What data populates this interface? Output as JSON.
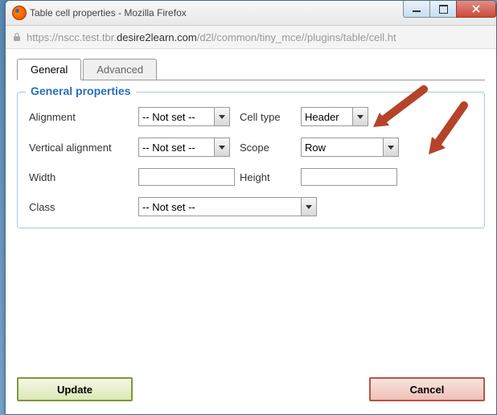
{
  "window": {
    "title": "Table cell properties - Mozilla Firefox",
    "url_pre": "https://nscc.test.tbr.",
    "url_domain": "desire2learn.com",
    "url_post": "/d2l/common/tiny_mce//plugins/table/cell.ht"
  },
  "tabs": {
    "general": "General",
    "advanced": "Advanced"
  },
  "fieldset": {
    "legend": "General properties"
  },
  "labels": {
    "alignment": "Alignment",
    "valign": "Vertical alignment",
    "width": "Width",
    "class": "Class",
    "celltype": "Cell type",
    "scope": "Scope",
    "height": "Height"
  },
  "values": {
    "alignment": "-- Not set --",
    "valign": "-- Not set --",
    "width": "",
    "class": "-- Not set --",
    "celltype": "Header",
    "scope": "Row",
    "height": ""
  },
  "buttons": {
    "update": "Update",
    "cancel": "Cancel"
  },
  "colors": {
    "annotation_arrow": "#b5432a"
  }
}
